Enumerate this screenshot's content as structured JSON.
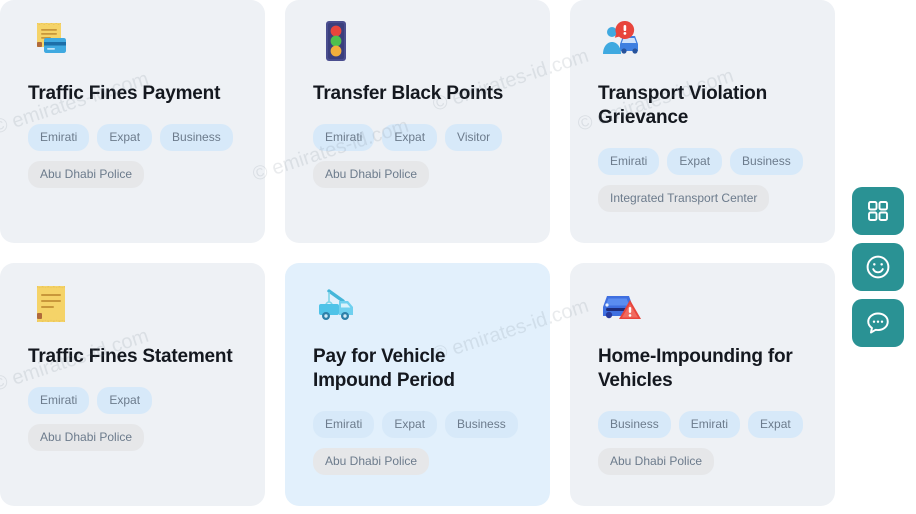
{
  "page": {
    "background_color": "#ffffff",
    "card_background": "#eef1f5",
    "card_highlight_background": "#e2f0fc",
    "tag_background": "#d7e9f9",
    "agency_tag_background": "#e6e7e9",
    "accent_color": "#2a9294",
    "title_color": "#14181f"
  },
  "cards": [
    {
      "icon": "receipt-card-payment-icon",
      "title": "Traffic Fines Payment",
      "tags": [
        "Emirati",
        "Expat",
        "Business"
      ],
      "agency": "Abu Dhabi Police",
      "highlighted": false
    },
    {
      "icon": "traffic-light-icon",
      "title": "Transfer Black Points",
      "tags": [
        "Emirati",
        "Expat",
        "Visitor"
      ],
      "agency": "Abu Dhabi Police",
      "highlighted": false
    },
    {
      "icon": "person-car-complaint-icon",
      "title": "Transport Violation Grievance",
      "tags": [
        "Emirati",
        "Expat",
        "Business"
      ],
      "agency": "Integrated Transport Center",
      "highlighted": false
    },
    {
      "icon": "receipt-document-icon",
      "title": "Traffic Fines Statement",
      "tags": [
        "Emirati",
        "Expat"
      ],
      "agency": "Abu Dhabi Police",
      "highlighted": false
    },
    {
      "icon": "tow-truck-icon",
      "title": "Pay for Vehicle Impound Period",
      "tags": [
        "Emirati",
        "Expat",
        "Business"
      ],
      "agency": "Abu Dhabi Police",
      "highlighted": true
    },
    {
      "icon": "car-warning-icon",
      "title": "Home-Impounding for Vehicles",
      "tags": [
        "Business",
        "Emirati",
        "Expat"
      ],
      "agency": "Abu Dhabi Police",
      "highlighted": false
    }
  ],
  "floating_actions": [
    {
      "icon": "apps-grid-icon",
      "name": "apps-grid-button"
    },
    {
      "icon": "smiley-face-icon",
      "name": "feedback-smiley-button"
    },
    {
      "icon": "chat-bubble-icon",
      "name": "chat-support-button"
    }
  ],
  "watermarks": [
    "© emirates-id.com",
    "© emirates-id.com",
    "© emirates-id.com",
    "© emirates-id.com",
    "© emirates-id.com",
    "© emirates-id.com"
  ]
}
